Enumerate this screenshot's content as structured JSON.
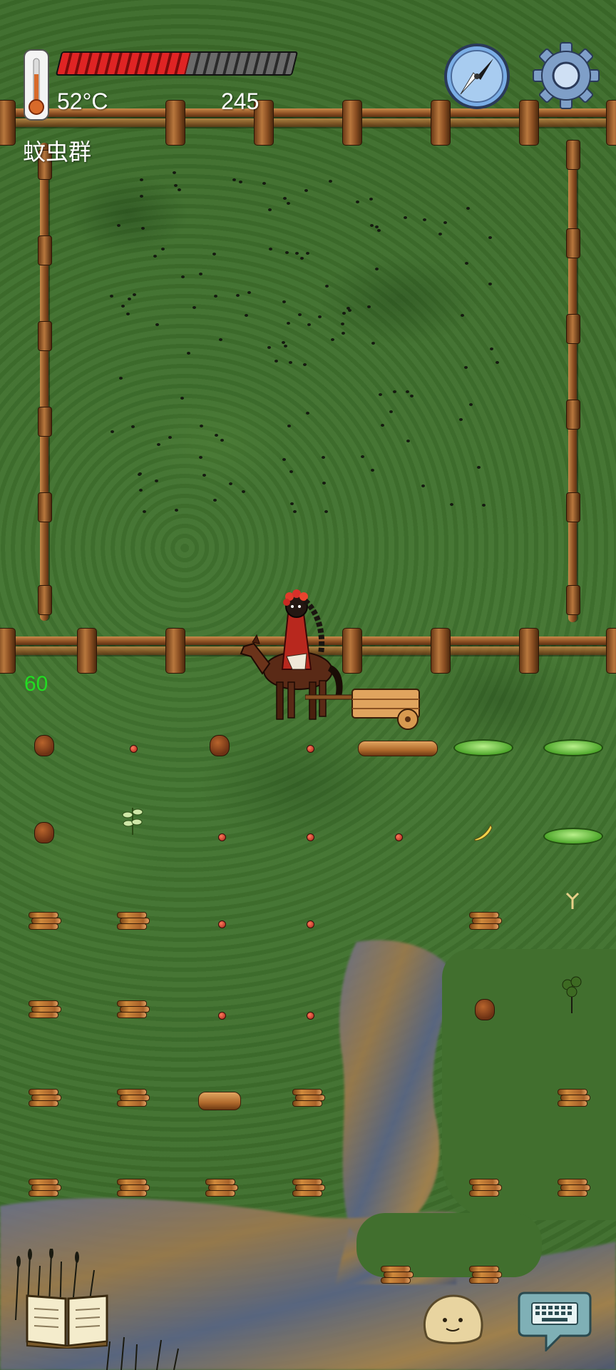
{
  "hud": {
    "temperature": "52°C",
    "counter": "245",
    "location": "蚊虫群",
    "side_number": "60",
    "health_fraction": 0.55
  },
  "icons": {
    "thermometer": "thermometer-icon",
    "compass": "compass-icon",
    "settings": "gear-icon",
    "recipe_book": "book-icon",
    "emote": "face-icon",
    "keyboard": "keyboard-icon"
  },
  "colors": {
    "grass": "#3f6f2c",
    "health_red": "#e02424",
    "side_number_green": "#22dd22"
  }
}
